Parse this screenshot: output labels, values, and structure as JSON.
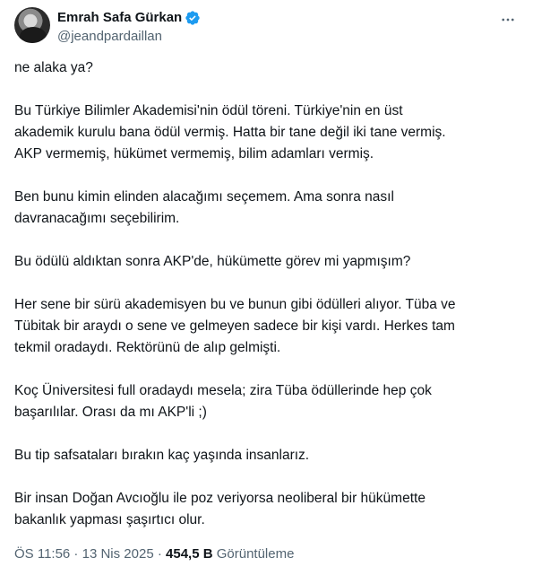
{
  "author": {
    "display_name": "Emrah Safa Gürkan",
    "handle": "@jeandpardaillan",
    "verified_color": "#1d9bf0"
  },
  "icons": {
    "verified": "verified-badge-icon",
    "more": "more-options-icon"
  },
  "tweet": {
    "paragraphs": [
      "ne alaka ya?",
      "Bu Türkiye Bilimler Akademisi'nin ödül töreni. Türkiye'nin en üst\nakademik kurulu bana ödül vermiş. Hatta bir tane değil iki tane vermiş.\nAKP vermemiş, hükümet vermemiş, bilim adamları vermiş.",
      "Ben bunu kimin elinden alacağımı seçemem. Ama sonra nasıl\ndavranacağımı seçebilirim.",
      "Bu ödülü aldıktan sonra AKP'de, hükümette görev mi yapmışım?",
      "Her sene bir sürü akademisyen bu ve bunun gibi ödülleri alıyor. Tüba ve\nTübitak bir araydı o sene ve gelmeyen sadece bir kişi vardı. Herkes tam\ntekmil oradaydı. Rektörünü de alıp gelmişti.",
      "Koç Üniversitesi full oradaydı mesela; zira Tüba ödüllerinde hep çok\nbaşarılılar. Orası da mı AKP'li ;)",
      "Bu tip safsataları bırakın kaç yaşında insanlarız.",
      "Bir insan Doğan Avcıoğlu ile poz veriyorsa neoliberal bir hükümette\nbakanlık yapması şaşırtıcı olur."
    ]
  },
  "meta": {
    "time": "ÖS 11:56",
    "separator": " · ",
    "date": "13 Nis 2025",
    "views_count": "454,5 B",
    "views_label": "Görüntüleme"
  }
}
